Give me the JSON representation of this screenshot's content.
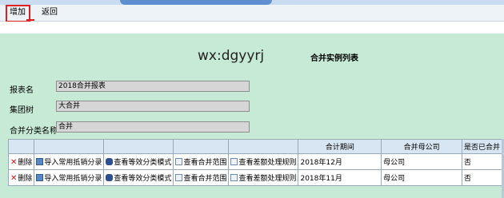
{
  "toolbar": {
    "add_label": "增加",
    "back_label": "返回"
  },
  "header": {
    "watermark": "wx:dgyyrj",
    "title": "合并实例列表"
  },
  "form": {
    "report_name_label": "报表名",
    "report_name_value": "2018合并报表",
    "group_label": "集团树",
    "group_value": "大合并",
    "category_label": "合并分类名称",
    "category_value": "合并"
  },
  "table": {
    "columns": [
      "",
      "",
      "",
      "",
      "",
      "合计期间",
      "合并母公司",
      "是否已合并"
    ],
    "actions": {
      "delete": "删除",
      "import": "导入常用抵销分录",
      "view_template": "查看等效分类模式",
      "view_scope": "查看合并范围",
      "view_diff": "查看差额处理规则"
    },
    "rows": [
      {
        "period": "2018年12月",
        "parent": "母公司",
        "merged": "否"
      },
      {
        "period": "2018年11月",
        "parent": "母公司",
        "merged": "否"
      }
    ]
  }
}
